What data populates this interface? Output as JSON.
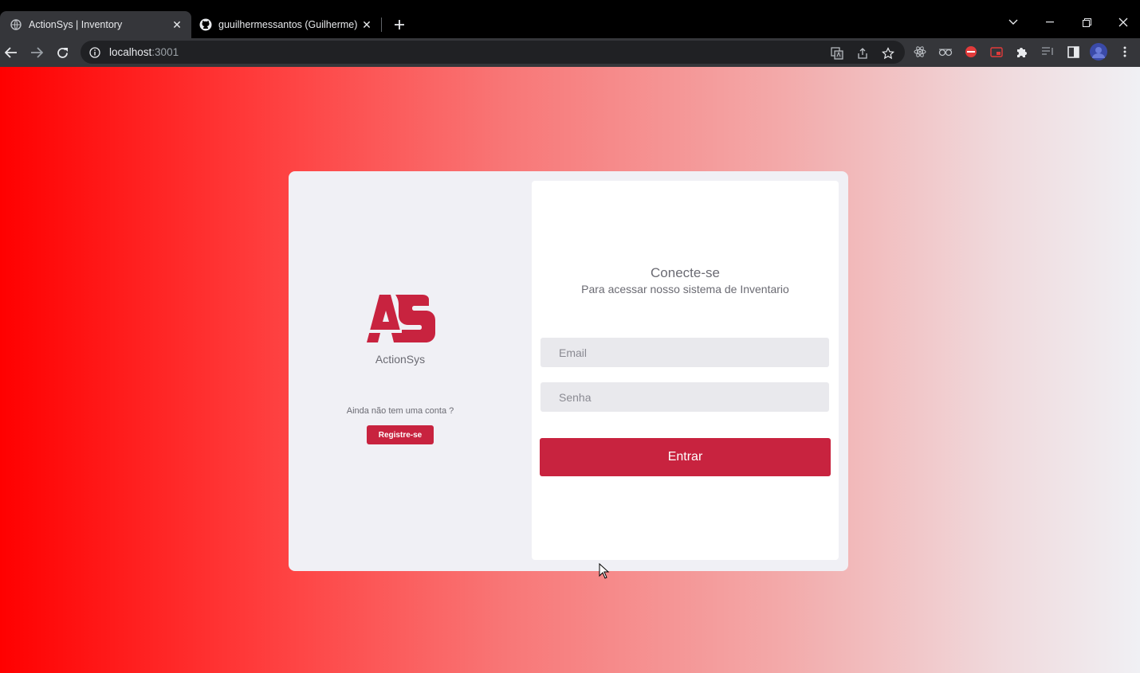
{
  "browser": {
    "tabs": [
      {
        "title": "ActionSys | Inventory",
        "active": true
      },
      {
        "title": "guuilhermessantos (Guilherme)",
        "active": false
      }
    ],
    "url_host": "localhost",
    "url_port": ":3001"
  },
  "brand": {
    "name": "ActionSys",
    "color": "#c8233f"
  },
  "left_panel": {
    "no_account_text": "Ainda não tem uma conta ?",
    "register_label": "Registre-se"
  },
  "login": {
    "title": "Conecte-se",
    "subtitle": "Para acessar nosso sistema de Inventario",
    "email_placeholder": "Email",
    "password_placeholder": "Senha",
    "submit_label": "Entrar"
  }
}
